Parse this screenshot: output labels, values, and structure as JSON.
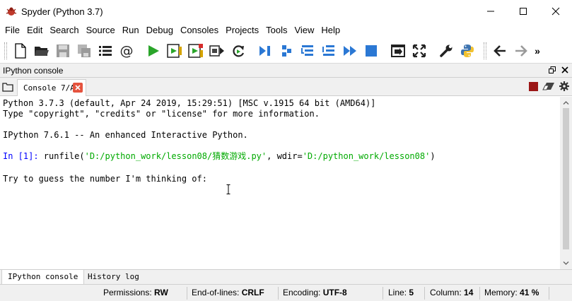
{
  "window": {
    "title": "Spyder (Python 3.7)",
    "controls": [
      "minimize-icon",
      "maximize-icon",
      "close-icon"
    ]
  },
  "menu": [
    "File",
    "Edit",
    "Search",
    "Source",
    "Run",
    "Debug",
    "Consoles",
    "Projects",
    "Tools",
    "View",
    "Help"
  ],
  "toolbar": {
    "icons": [
      "new-file-icon",
      "open-file-icon",
      "save-icon",
      "save-all-icon",
      "list-icon",
      "at-sign-icon",
      "run-icon",
      "run-cell-icon",
      "run-cell-advance-icon",
      "run-selection-icon",
      "rerun-icon",
      "debug-icon",
      "step-icon",
      "step-into-icon",
      "step-return-icon",
      "continue-icon",
      "stop-debug-icon",
      "maximize-pane-icon",
      "fullscreen-icon",
      "wrench-icon",
      "python-icon",
      "back-arrow-icon",
      "forward-arrow-icon"
    ],
    "overflow_glyph": "»"
  },
  "pane": {
    "title": "IPython console"
  },
  "console_tab": {
    "label": "Console 7/A"
  },
  "console": {
    "line1": "Python 3.7.3 (default, Apr 24 2019, 15:29:51) [MSC v.1915 64 bit (AMD64)]",
    "line2": "Type \"copyright\", \"credits\" or \"license\" for more information.",
    "line3": "IPython 7.6.1 -- An enhanced Interactive Python.",
    "prompt": "In [1]:",
    "cmd_pre": " runfile(",
    "cmd_str1": "'D:/python_work/lesson08/猜数游戏.py'",
    "cmd_mid": ", wdir=",
    "cmd_str2": "'D:/python_work/lesson08'",
    "cmd_post": ")",
    "line5": "Try to guess the number I'm thinking of:"
  },
  "bottom_tabs": [
    "IPython console",
    "History log"
  ],
  "status": {
    "permissions_label": "Permissions:",
    "permissions_value": "RW",
    "eol_label": "End-of-lines:",
    "eol_value": "CRLF",
    "encoding_label": "Encoding:",
    "encoding_value": "UTF-8",
    "line_label": "Line:",
    "line_value": "5",
    "column_label": "Column:",
    "column_value": "14",
    "memory_label": "Memory:",
    "memory_value": "41 %"
  },
  "colors": {
    "prompt": "#0000ff",
    "string": "#00aa00",
    "run_green": "#2aa52a",
    "debug_blue": "#2b78d4",
    "stop_red": "#9b1616",
    "tab_close": "#e5533e"
  }
}
